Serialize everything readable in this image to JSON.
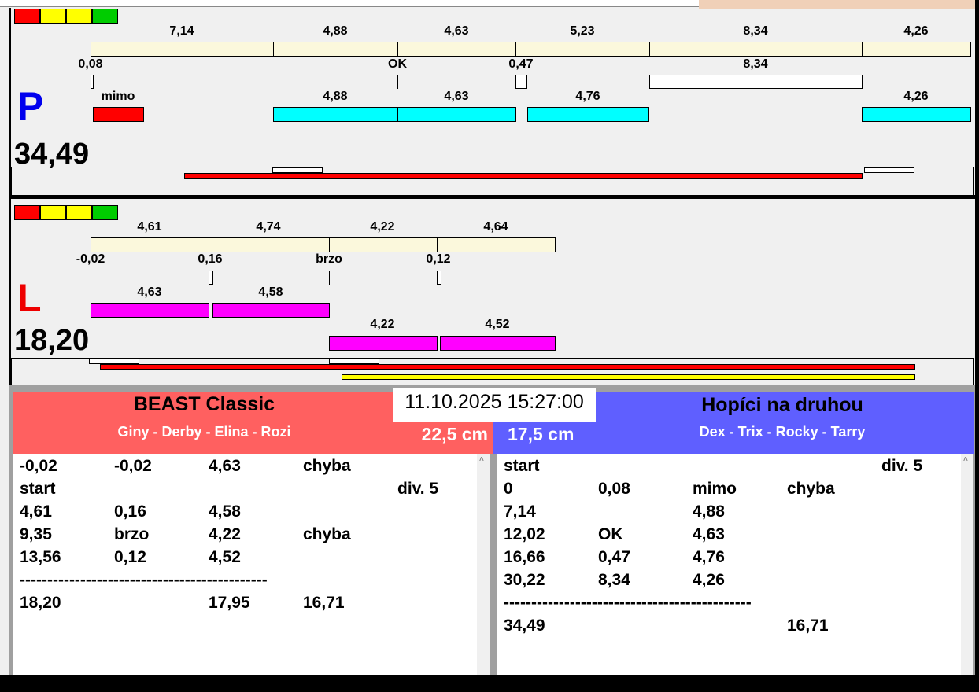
{
  "colors": {
    "red": "#ff0000",
    "yellow": "#ffff00",
    "green": "#00cc00",
    "cyan": "#00ffff",
    "magenta": "#ff00ff",
    "team_left": "#ff6060",
    "team_right": "#5f5fff"
  },
  "lane_p": {
    "letter": "P",
    "total": "34,49",
    "times": [
      "7,14",
      "4,88",
      "4,63",
      "5,23",
      "8,34",
      "4,26"
    ],
    "offsets": [
      "0,08",
      "OK",
      "0,47",
      "8,34"
    ],
    "runs": [
      "mimo",
      "4,88",
      "4,63",
      "4,76",
      "4,26"
    ]
  },
  "lane_l": {
    "letter": "L",
    "total": "18,20",
    "times": [
      "4,61",
      "4,74",
      "4,22",
      "4,64"
    ],
    "offsets": [
      "-0,02",
      "0,16",
      "brzo",
      "0,12"
    ],
    "runs_a": [
      "4,63",
      "4,58"
    ],
    "runs_b": [
      "4,22",
      "4,52"
    ]
  },
  "datetime": "11.10.2025 15:27:00",
  "team_left": {
    "name": "BEAST Classic",
    "dogs": "Giny - Derby - Elina - Rozi",
    "height": "22,5 cm",
    "rows": [
      [
        "-0,02",
        "-0,02",
        "4,63",
        "chyba",
        ""
      ],
      [
        "start",
        "",
        "",
        "",
        "div.  5"
      ],
      [
        "4,61",
        "0,16",
        "4,58",
        "",
        ""
      ],
      [
        "9,35",
        "brzo",
        "4,22",
        "chyba",
        ""
      ],
      [
        "13,56",
        "0,12",
        "4,52",
        "",
        ""
      ],
      [
        "---------------------------------------------",
        "",
        "",
        "",
        ""
      ],
      [
        "18,20",
        "",
        "17,95",
        "16,71",
        ""
      ]
    ]
  },
  "team_right": {
    "name": "Hopíci na druhou",
    "dogs": "Dex - Trix - Rocky - Tarry",
    "height": "17,5 cm",
    "rows": [
      [
        "start",
        "",
        "",
        "",
        "div.  5"
      ],
      [
        "0",
        "0,08",
        "mimo",
        "chyba",
        ""
      ],
      [
        "7,14",
        "",
        "4,88",
        "",
        ""
      ],
      [
        "12,02",
        "OK",
        "4,63",
        "",
        ""
      ],
      [
        "16,66",
        "0,47",
        "4,76",
        "",
        ""
      ],
      [
        "30,22",
        "8,34",
        "4,26",
        "",
        ""
      ],
      [
        "---------------------------------------------",
        "",
        "",
        "",
        ""
      ],
      [
        "34,49",
        "",
        "",
        "16,71",
        ""
      ]
    ]
  }
}
